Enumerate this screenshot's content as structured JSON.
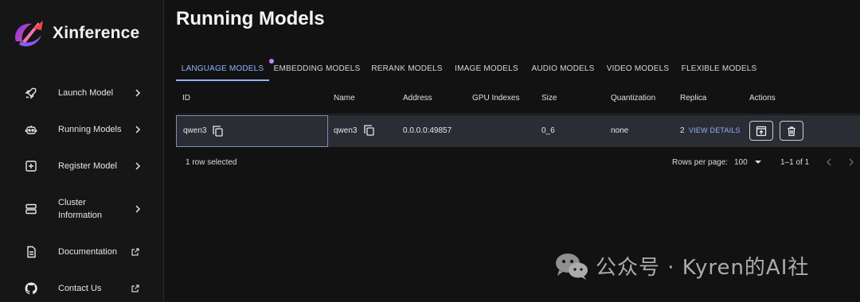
{
  "brand": {
    "name": "Xinference"
  },
  "sidebar": {
    "items": [
      {
        "label": "Launch Model",
        "icon": "rocket-icon",
        "trailing": "chevron-right-icon"
      },
      {
        "label": "Running Models",
        "icon": "robot-icon",
        "trailing": "chevron-right-icon"
      },
      {
        "label": "Register Model",
        "icon": "add-box-icon",
        "trailing": "chevron-right-icon"
      },
      {
        "label": "Cluster Information",
        "icon": "server-icon",
        "trailing": "chevron-right-icon"
      },
      {
        "label": "Documentation",
        "icon": "document-icon",
        "trailing": "external-link-icon"
      },
      {
        "label": "Contact Us",
        "icon": "github-icon",
        "trailing": "external-link-icon"
      }
    ]
  },
  "main": {
    "title": "Running Models",
    "tabs": [
      {
        "label": "LANGUAGE MODELS",
        "active": true
      },
      {
        "label": "EMBEDDING MODELS",
        "active": false
      },
      {
        "label": "RERANK MODELS",
        "active": false
      },
      {
        "label": "IMAGE MODELS",
        "active": false
      },
      {
        "label": "AUDIO MODELS",
        "active": false
      },
      {
        "label": "VIDEO MODELS",
        "active": false
      },
      {
        "label": "FLEXIBLE MODELS",
        "active": false
      }
    ],
    "table": {
      "columns": [
        "ID",
        "Name",
        "Address",
        "GPU Indexes",
        "Size",
        "Quantization",
        "Replica",
        "Actions"
      ],
      "rows": [
        {
          "id": "qwen3",
          "name": "qwen3",
          "address": "0.0.0.0:49857",
          "gpu_indexes": "",
          "size": "0_6",
          "quantization": "none",
          "replica": "2",
          "view_details": "VIEW DETAILS",
          "actions": [
            "open-in-new-icon",
            "trash-icon"
          ]
        }
      ],
      "footer": {
        "selected": "1 row selected",
        "rows_per_page_label": "Rows per page:",
        "rows_per_page_value": "100",
        "range": "1–1 of 1"
      }
    }
  },
  "colors": {
    "accent": "#8fb4ff",
    "tab_dot": "#c084fc",
    "selected_row": "#2a2d33",
    "background": "#121212"
  },
  "watermark": {
    "text": "公众号 · Kyren的AI社",
    "icon": "wechat-icon"
  }
}
